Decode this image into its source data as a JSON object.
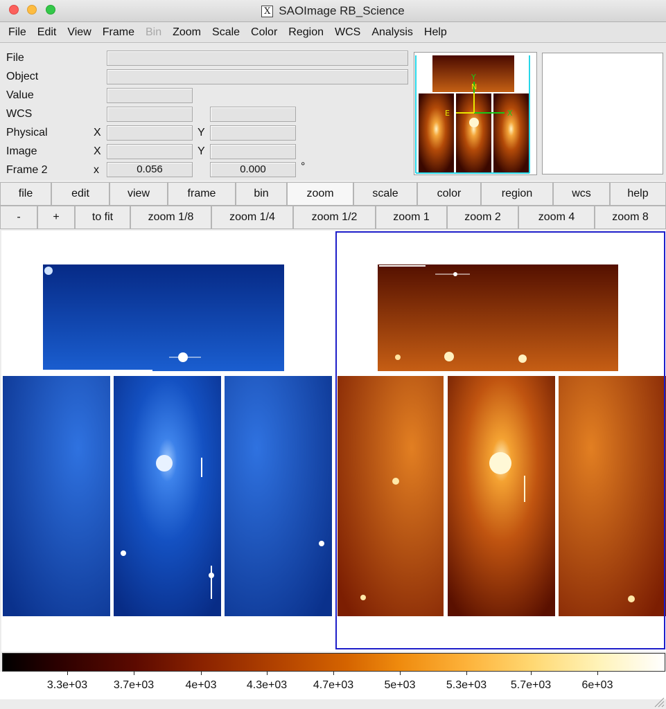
{
  "window": {
    "title": "SAOImage RB_Science"
  },
  "menu": [
    "File",
    "Edit",
    "View",
    "Frame",
    "Bin",
    "Zoom",
    "Scale",
    "Color",
    "Region",
    "WCS",
    "Analysis",
    "Help"
  ],
  "menu_disabled": [
    "Bin"
  ],
  "info": {
    "file_label": "File",
    "object_label": "Object",
    "value_label": "Value",
    "wcs_label": "WCS",
    "physical_label": "Physical",
    "image_label": "Image",
    "frame_label": "Frame 2",
    "x_label": "X",
    "y_label": "Y",
    "frame_x_label": "x",
    "frame_zoom": "0.056",
    "frame_angle": "0.000",
    "degree_symbol": "°"
  },
  "panner": {
    "north_label": "N",
    "east_label": "E",
    "y_label": "Y",
    "x_label": "X"
  },
  "buttons_row1": [
    "file",
    "edit",
    "view",
    "frame",
    "bin",
    "zoom",
    "scale",
    "color",
    "region",
    "wcs",
    "help"
  ],
  "buttons_row1_active": "zoom",
  "buttons_row2": [
    "-",
    "+",
    "to fit",
    "zoom 1/8",
    "zoom 1/4",
    "zoom 1/2",
    "zoom 1",
    "zoom 2",
    "zoom 4",
    "zoom 8"
  ],
  "colorbar": {
    "labels": [
      "3.3e+03",
      "3.7e+03",
      "4e+03",
      "4.3e+03",
      "4.7e+03",
      "5e+03",
      "5.3e+03",
      "5.7e+03",
      "6e+03"
    ]
  },
  "colors": {
    "frame_highlight": "#1d1dc9",
    "panner_cyan": "#27d7e8",
    "compass_green": "#18c818",
    "compass_yellow": "#e8e800"
  }
}
